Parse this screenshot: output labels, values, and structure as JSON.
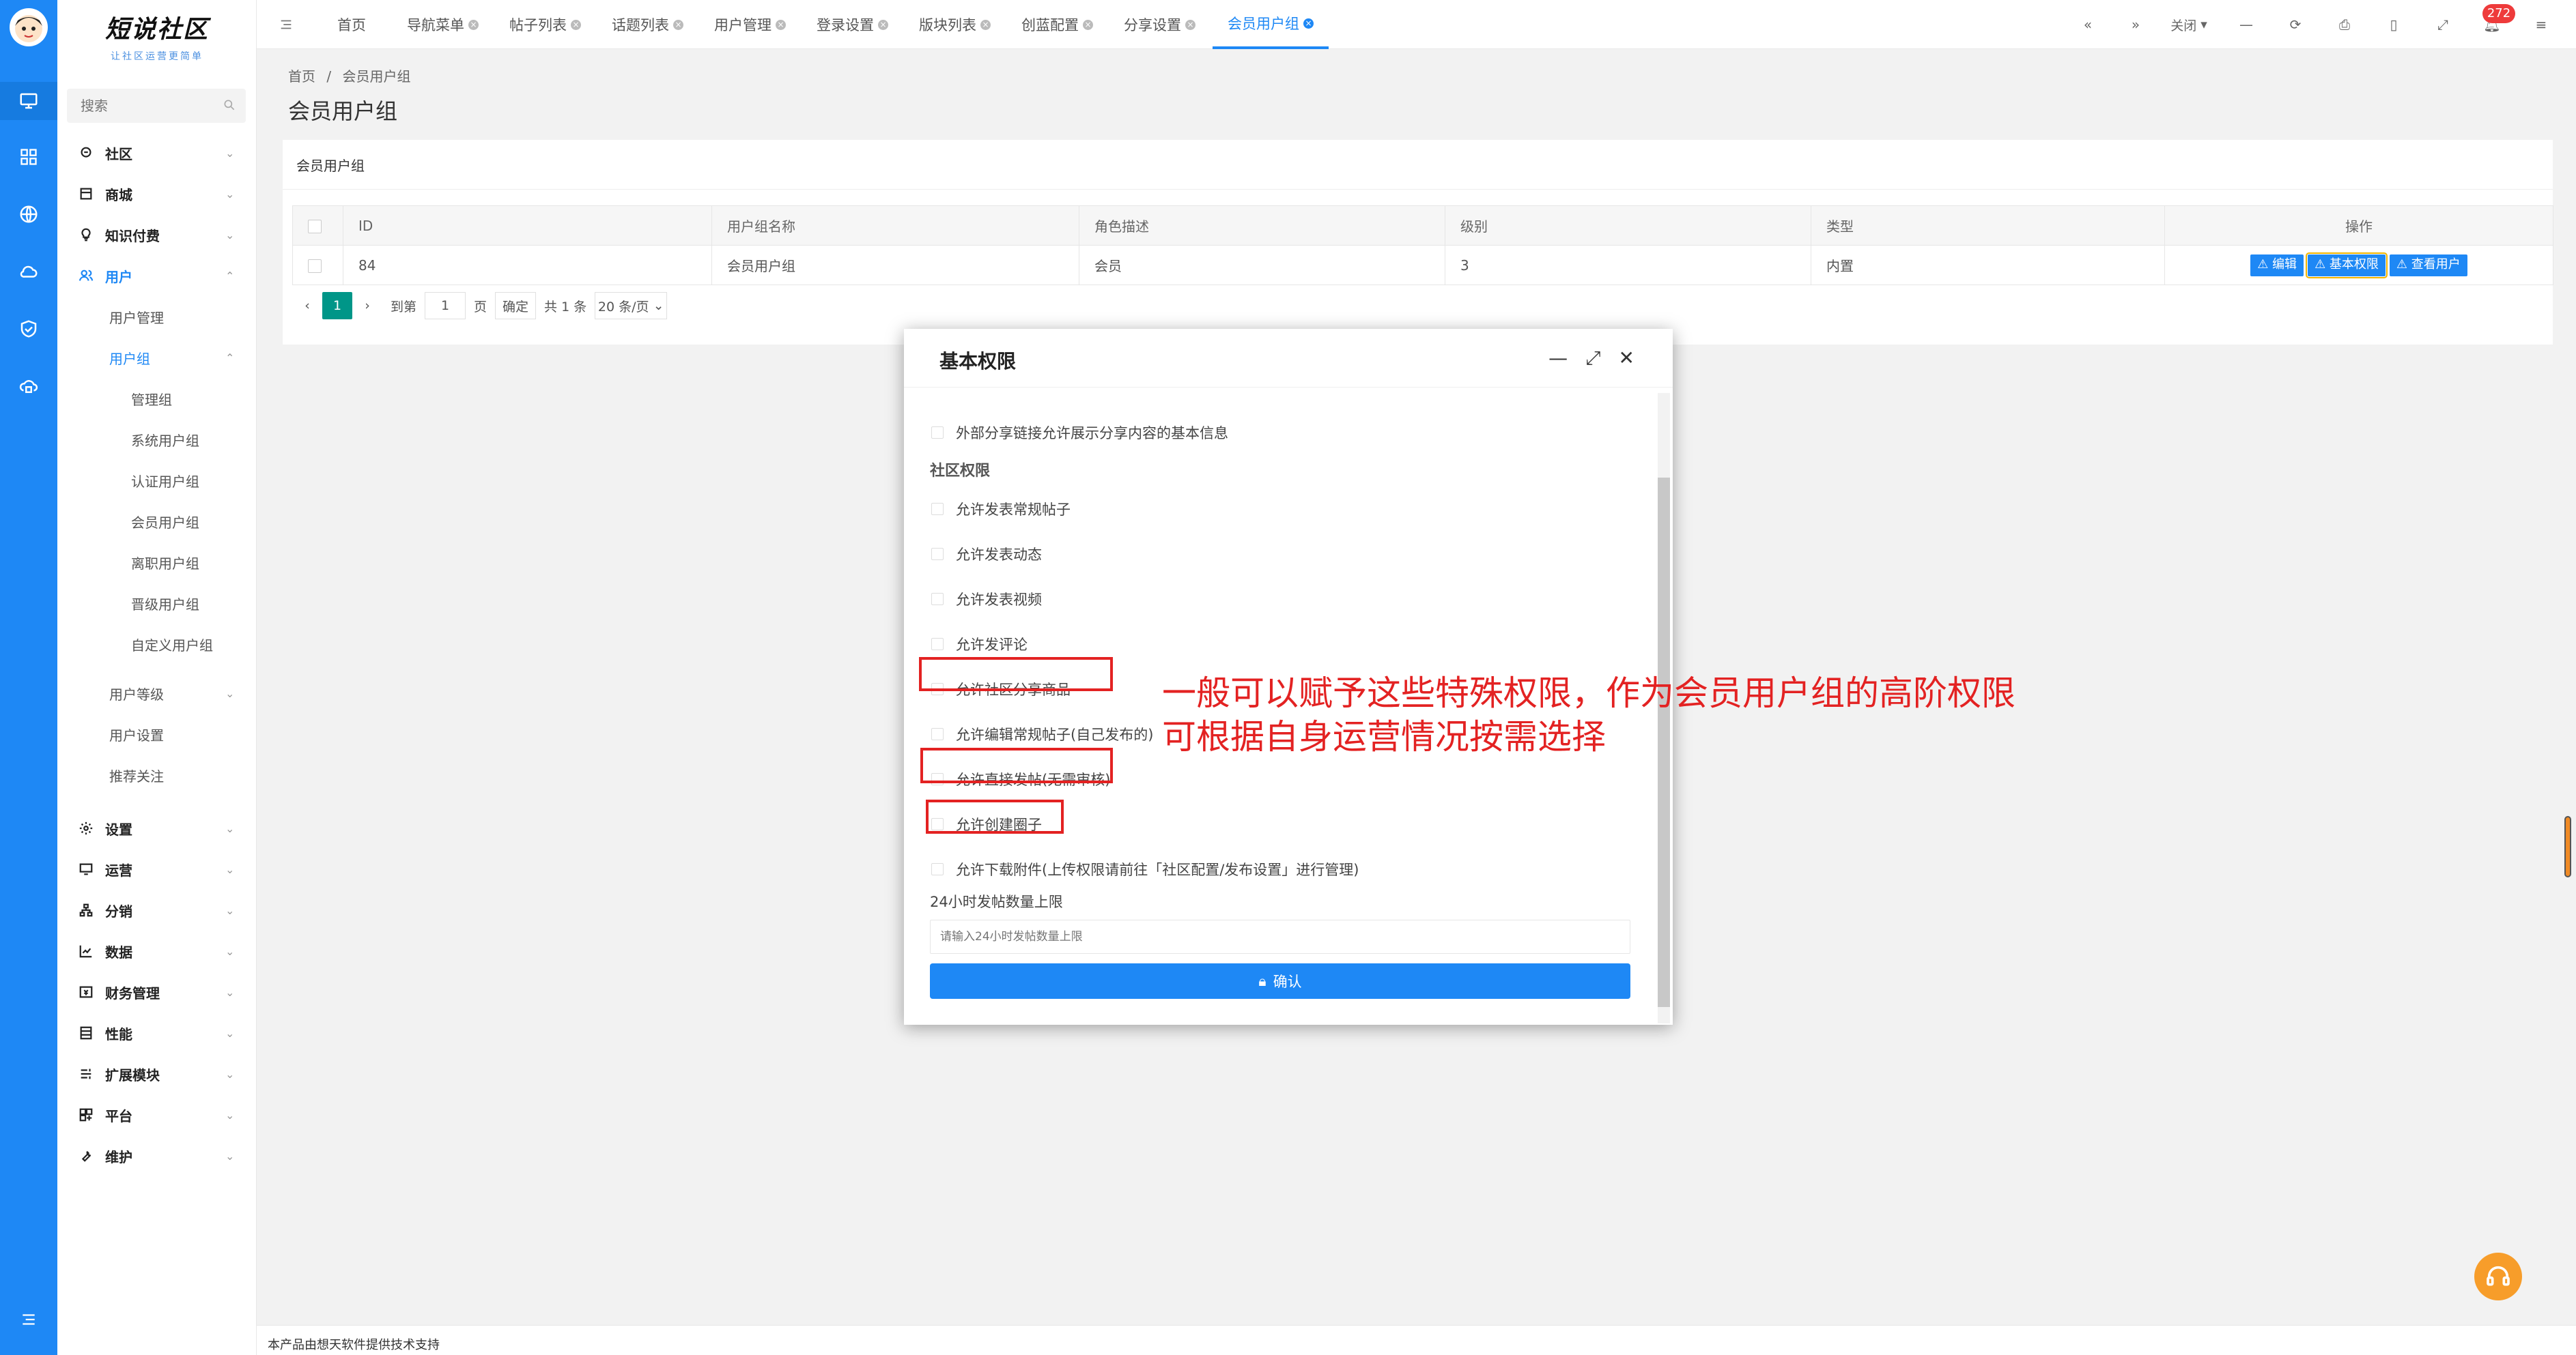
{
  "app": {
    "logo_title": "短说社区",
    "logo_slogan": "让社区运营更简单"
  },
  "search": {
    "placeholder": "搜索"
  },
  "sidebar": {
    "items": [
      {
        "label": "社区"
      },
      {
        "label": "商城"
      },
      {
        "label": "知识付费"
      },
      {
        "label": "用户"
      },
      {
        "label": "用户管理"
      },
      {
        "label": "用户组"
      },
      {
        "label": "管理组"
      },
      {
        "label": "系统用户组"
      },
      {
        "label": "认证用户组"
      },
      {
        "label": "会员用户组"
      },
      {
        "label": "离职用户组"
      },
      {
        "label": "晋级用户组"
      },
      {
        "label": "自定义用户组"
      },
      {
        "label": "用户等级"
      },
      {
        "label": "用户设置"
      },
      {
        "label": "推荐关注"
      },
      {
        "label": "设置"
      },
      {
        "label": "运营"
      },
      {
        "label": "分销"
      },
      {
        "label": "数据"
      },
      {
        "label": "财务管理"
      },
      {
        "label": "性能"
      },
      {
        "label": "扩展模块"
      },
      {
        "label": "平台"
      },
      {
        "label": "维护"
      }
    ]
  },
  "tabs": [
    {
      "label": "首页"
    },
    {
      "label": "导航菜单"
    },
    {
      "label": "帖子列表"
    },
    {
      "label": "话题列表"
    },
    {
      "label": "用户管理"
    },
    {
      "label": "登录设置"
    },
    {
      "label": "版块列表"
    },
    {
      "label": "创蓝配置"
    },
    {
      "label": "分享设置"
    },
    {
      "label": "会员用户组"
    }
  ],
  "toolbar": {
    "close_label": "关闭",
    "notify_count": "272"
  },
  "breadcrumb": {
    "home": "首页",
    "sep": "/",
    "current": "会员用户组"
  },
  "page": {
    "title": "会员用户组",
    "panel_title": "会员用户组"
  },
  "table": {
    "headers": [
      "ID",
      "用户组名称",
      "角色描述",
      "级别",
      "类型",
      "操作"
    ],
    "rows": [
      {
        "id": "84",
        "name": "会员用户组",
        "desc": "会员",
        "level": "3",
        "type": "内置"
      }
    ],
    "actions": [
      "编辑",
      "基本权限",
      "查看用户"
    ]
  },
  "pager": {
    "current": "1",
    "goto_label": "到第",
    "goto_value": "1",
    "page_unit": "页",
    "confirm": "确定",
    "total": "共 1 条",
    "per_page": "20 条/页"
  },
  "modal": {
    "title": "基本权限",
    "top_option": "外部分享链接允许展示分享内容的基本信息",
    "section": "社区权限",
    "options": [
      "允许发表常规帖子",
      "允许发表动态",
      "允许发表视频",
      "允许发评论",
      "允许社区分享商品",
      "允许编辑常规帖子(自己发布的)",
      "允许直接发帖(无需审核)",
      "允许创建圈子",
      "允许下载附件(上传权限请前往「社区配置/发布设置」进行管理)"
    ],
    "limit_label": "24小时发帖数量上限",
    "limit_placeholder": "请输入24小时发帖数量上限",
    "confirm_label": "确认"
  },
  "annotation": {
    "line1": "一般可以赋予这些特殊权限，作为会员用户组的高阶权限",
    "line2": "可根据自身运营情况按需选择"
  },
  "footer": {
    "text": "本产品由想天软件提供技术支持"
  },
  "colors": {
    "primary": "#1e88f5",
    "annotation_red": "#e32222",
    "pager_active": "#009688",
    "help": "#f79d2a"
  }
}
